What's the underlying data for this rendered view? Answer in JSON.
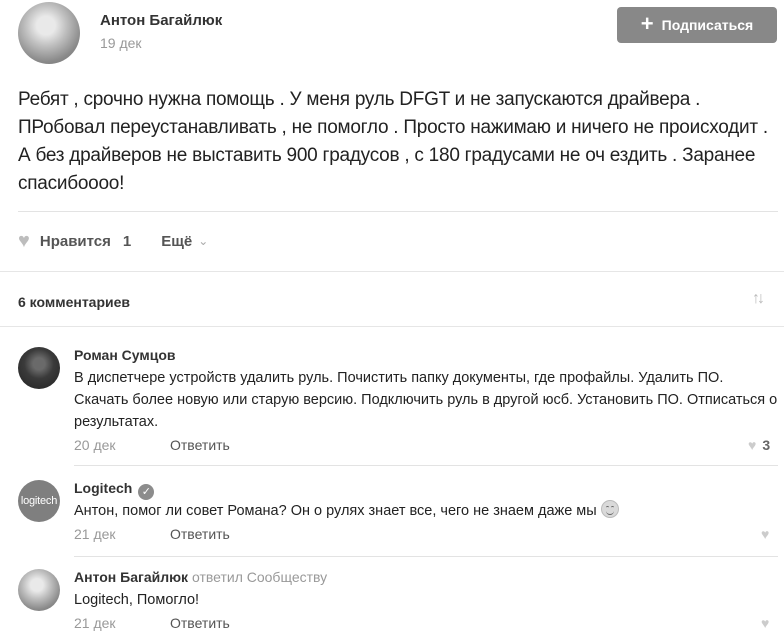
{
  "post": {
    "author": "Антон Багайлюк",
    "date": "19 дек",
    "subscribe_label": "Подписаться",
    "text": "Ребят , срочно нужна помощь . У меня руль DFGT и не запускаются драйвера . ПРобовал переустанавливать , не помогло . Просто нажимаю и ничего не происходит . А без драйверов не выставить 900 градусов , с 180 градусами не оч ездить . Заранее спасибоооо!",
    "like_label": "Нравится",
    "like_count": "1",
    "more_label": "Ещё"
  },
  "comments_header": "6 комментариев",
  "comments": [
    {
      "author": "Роман Сумцов",
      "text": "В диспетчере устройств удалить руль. Почистить папку документы, где профайлы. Удалить ПО. Скачать более новую или старую версию. Подключить руль в другой юсб. Установить ПО. Отписаться о результатах.",
      "date": "20 дек",
      "answer_label": "Ответить",
      "likes": "3"
    },
    {
      "author": "Logitech",
      "avatar_text": "logitech",
      "text": "Антон, помог ли совет Романа? Он о рулях знает все, чего не знаем даже мы",
      "date": "21 дек",
      "answer_label": "Ответить"
    },
    {
      "author": "Антон Багайлюк",
      "reply_to": "ответил Сообществу",
      "text": "Logitech, Помогло!",
      "date": "21 дек",
      "answer_label": "Ответить"
    }
  ],
  "colors": {
    "button_bg": "#888888",
    "muted": "#999999"
  },
  "icons": [
    "plus-icon",
    "heart-icon",
    "chevron-down-icon",
    "sort-icon",
    "verified-icon",
    "smiley-icon"
  ]
}
